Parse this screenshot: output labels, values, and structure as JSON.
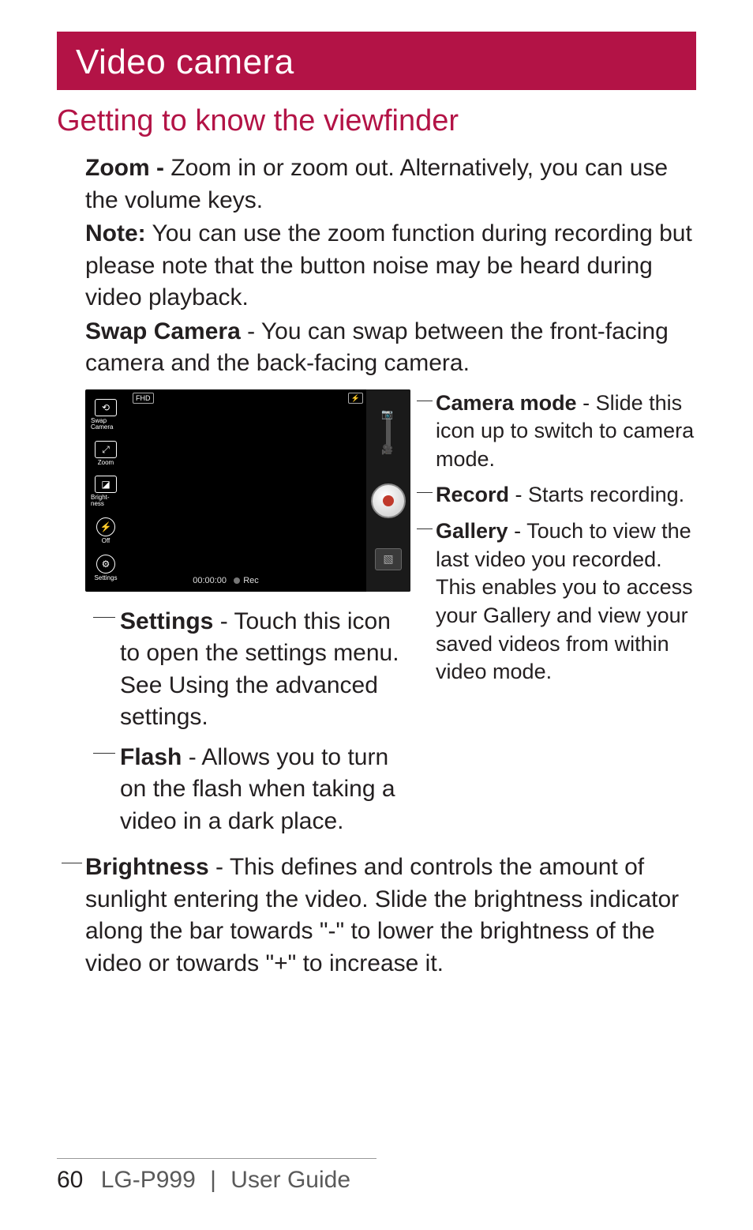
{
  "chapter_title": "Video camera",
  "section_title": "Getting to know the viewfinder",
  "zoom": {
    "label": "Zoom -",
    "text": " Zoom in or zoom out. Alternatively, you can use the volume keys."
  },
  "zoom_note": {
    "label": "Note:",
    "text": " You can use the zoom function during recording but please note that the button noise may be heard during video playback."
  },
  "swap": {
    "label": "Swap Camera",
    "text": " - You can swap between the front-facing camera and the back-facing camera."
  },
  "viewfinder": {
    "left_icons": [
      {
        "label": "Swap Camera",
        "glyph": "⟲"
      },
      {
        "label": "Zoom",
        "glyph": "⤢"
      },
      {
        "label": "Bright- ness",
        "glyph": "◪"
      },
      {
        "label": "Off",
        "glyph": "⚡"
      },
      {
        "label": "Settings",
        "glyph": "⚙"
      }
    ],
    "top_left_badge": "FHD",
    "top_right_badge": "⚡",
    "timer": "00:00:00",
    "rec_label": "Rec"
  },
  "camera_mode": {
    "label": "Camera mode",
    "text": " - Slide this icon up to switch to camera mode."
  },
  "record": {
    "label": "Record",
    "text": " - Starts recording."
  },
  "gallery": {
    "label": "Gallery",
    "text": " - Touch to view the last video you recorded. This enables you to access your Gallery and view your saved videos from within video mode."
  },
  "settings": {
    "label": "Settings",
    "text": " - Touch this icon to open the settings menu. See Using the advanced settings."
  },
  "flash": {
    "label": "Flash",
    "text": " - Allows you to turn on the flash when taking a video in a dark place."
  },
  "brightness": {
    "label": "Brightness",
    "text": " - This defines and controls the amount of sunlight entering the video. Slide the brightness indicator along the bar towards \"-\" to lower the brightness of the video or towards \"+\" to increase it."
  },
  "footer": {
    "page": "60",
    "model": "LG-P999",
    "sep": "|",
    "title": "User Guide"
  }
}
